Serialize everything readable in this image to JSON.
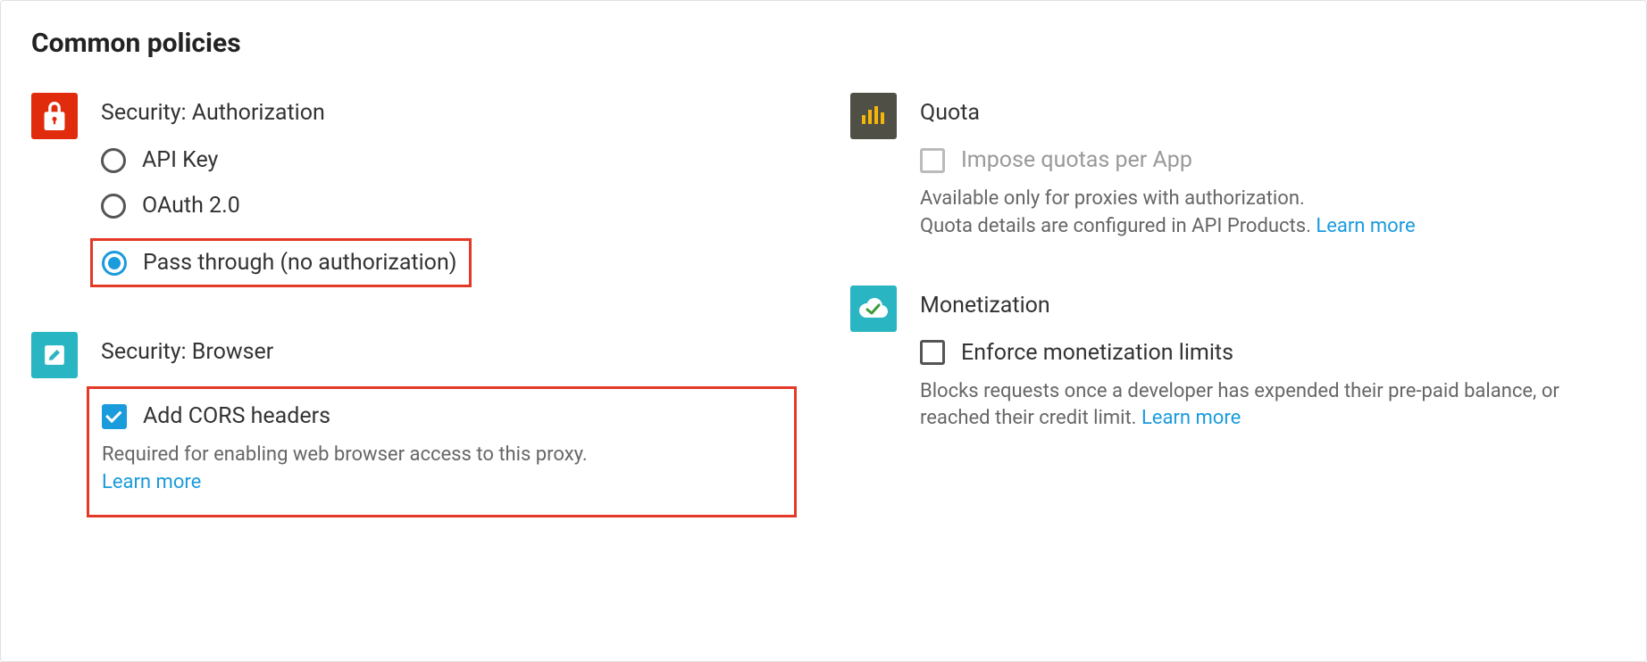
{
  "title": "Common policies",
  "security_auth": {
    "header": "Security: Authorization",
    "options": {
      "api_key": "API Key",
      "oauth": "OAuth 2.0",
      "pass_through": "Pass through (no authorization)"
    }
  },
  "security_browser": {
    "header": "Security: Browser",
    "checkbox_label": "Add CORS headers",
    "helper": "Required for enabling web browser access to this proxy.",
    "learn_more": "Learn more"
  },
  "quota": {
    "header": "Quota",
    "checkbox_label": "Impose quotas per App",
    "helper_line1": "Available only for proxies with authorization.",
    "helper_line2": "Quota details are configured in API Products. ",
    "learn_more": "Learn more"
  },
  "monetization": {
    "header": "Monetization",
    "checkbox_label": "Enforce monetization limits",
    "helper": "Blocks requests once a developer has expended their pre-paid balance, or reached their credit limit. ",
    "learn_more": "Learn more"
  }
}
